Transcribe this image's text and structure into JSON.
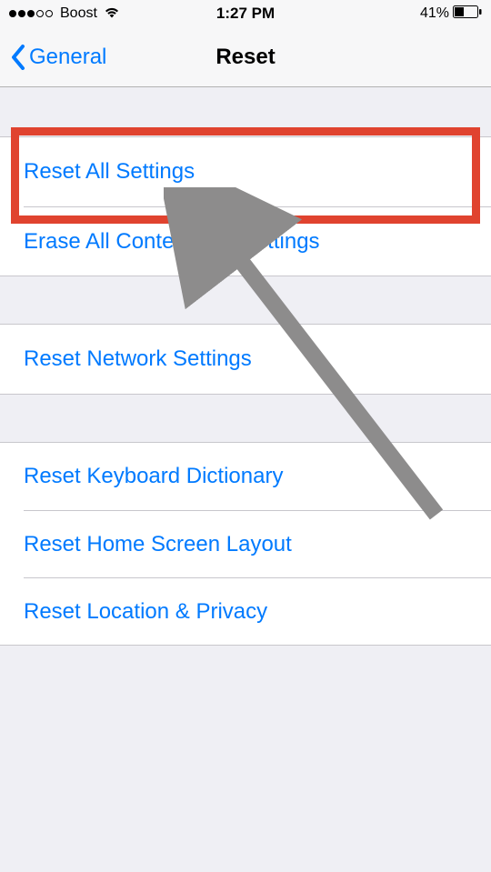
{
  "status_bar": {
    "carrier": "Boost",
    "time": "1:27 PM",
    "battery_percent": "41%"
  },
  "nav": {
    "back_label": "General",
    "title": "Reset"
  },
  "sections": {
    "group1": {
      "item0": "Reset All Settings",
      "item1": "Erase All Content and Settings"
    },
    "group2": {
      "item0": "Reset Network Settings"
    },
    "group3": {
      "item0": "Reset Keyboard Dictionary",
      "item1": "Reset Home Screen Layout",
      "item2": "Reset Location & Privacy"
    }
  },
  "annotation": {
    "highlight_target": "reset-all-settings"
  }
}
